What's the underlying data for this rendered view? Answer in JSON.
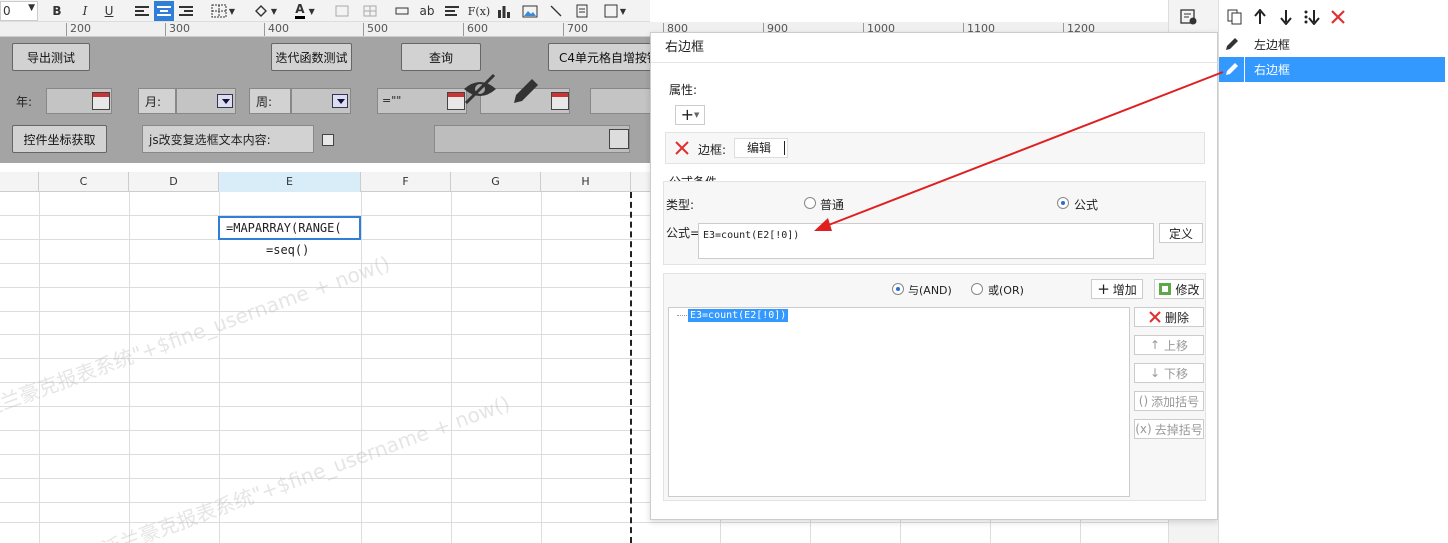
{
  "toolbar": {
    "font_size_value": "0",
    "bold": "B",
    "italic": "I",
    "underline": "U",
    "font_color": "A",
    "text_style_ab": "ab",
    "formula_fx": "F(x)"
  },
  "ruler": {
    "ticks": [
      "200",
      "300",
      "400",
      "500",
      "600",
      "700",
      "800",
      "900",
      "1000",
      "1100",
      "1200"
    ]
  },
  "form": {
    "export_test": "导出测试",
    "iter_func_test": "迭代函数测试",
    "query": "查询",
    "c4_button": "C4单元格自增按钮",
    "year_label": "年:",
    "month_label": "月:",
    "week_label": "周:",
    "eq_value": "=\"\"",
    "ctrl_coord": "控件坐标获取",
    "js_change": "js改变复选框文本内容:"
  },
  "sheet": {
    "columns": [
      "C",
      "D",
      "E",
      "F",
      "G",
      "H"
    ],
    "cell_e_formula": "=MAPARRAY(RANGE(",
    "cell_e_seq": "=seq()"
  },
  "watermark": {
    "text1": "\"泛兰豪克报表系统\"+$fine_username + now()",
    "text2": "\"泛兰豪克报表系统\"+$fine_username + now()"
  },
  "dialog": {
    "title": "右边框",
    "properties_label": "属性:",
    "border_label": "边框:",
    "edit_label": "编辑",
    "formula_condition_label": "公式条件",
    "type_label": "类型:",
    "type_normal": "普通",
    "type_formula": "公式",
    "formula_label": "公式=",
    "formula_value": "E3=count(E2[!0])",
    "define_button": "定义",
    "and_label": "与(AND)",
    "or_label": "或(OR)",
    "add_button": "增加",
    "modify_button": "修改",
    "condition_item": "E3=count(E2[!0])",
    "delete_button": "删除",
    "move_up_button": "上移",
    "move_down_button": "下移",
    "add_bracket_button": "添加括号",
    "remove_bracket_button": "去掉括号"
  },
  "right_panel": {
    "items": [
      {
        "label": "左边框",
        "selected": false
      },
      {
        "label": "右边框",
        "selected": true
      }
    ]
  },
  "colors": {
    "accent": "#3399ff",
    "annotation_arrow": "#e02020",
    "delete_red": "#e03030"
  }
}
